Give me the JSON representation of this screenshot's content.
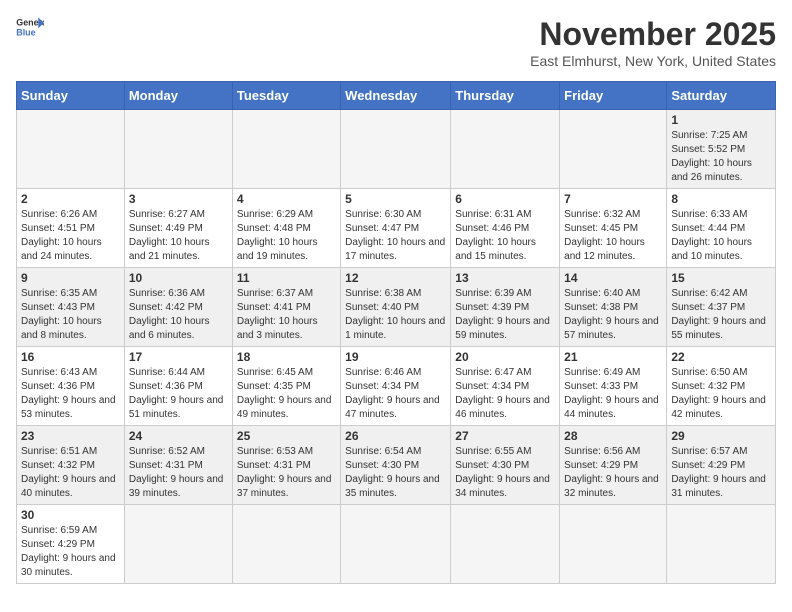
{
  "header": {
    "logo_general": "General",
    "logo_blue": "Blue",
    "month_title": "November 2025",
    "location": "East Elmhurst, New York, United States"
  },
  "weekdays": [
    "Sunday",
    "Monday",
    "Tuesday",
    "Wednesday",
    "Thursday",
    "Friday",
    "Saturday"
  ],
  "weeks": [
    [
      {
        "day": "",
        "info": ""
      },
      {
        "day": "",
        "info": ""
      },
      {
        "day": "",
        "info": ""
      },
      {
        "day": "",
        "info": ""
      },
      {
        "day": "",
        "info": ""
      },
      {
        "day": "",
        "info": ""
      },
      {
        "day": "1",
        "info": "Sunrise: 7:25 AM\nSunset: 5:52 PM\nDaylight: 10 hours and 26 minutes."
      }
    ],
    [
      {
        "day": "2",
        "info": "Sunrise: 6:26 AM\nSunset: 4:51 PM\nDaylight: 10 hours and 24 minutes."
      },
      {
        "day": "3",
        "info": "Sunrise: 6:27 AM\nSunset: 4:49 PM\nDaylight: 10 hours and 21 minutes."
      },
      {
        "day": "4",
        "info": "Sunrise: 6:29 AM\nSunset: 4:48 PM\nDaylight: 10 hours and 19 minutes."
      },
      {
        "day": "5",
        "info": "Sunrise: 6:30 AM\nSunset: 4:47 PM\nDaylight: 10 hours and 17 minutes."
      },
      {
        "day": "6",
        "info": "Sunrise: 6:31 AM\nSunset: 4:46 PM\nDaylight: 10 hours and 15 minutes."
      },
      {
        "day": "7",
        "info": "Sunrise: 6:32 AM\nSunset: 4:45 PM\nDaylight: 10 hours and 12 minutes."
      },
      {
        "day": "8",
        "info": "Sunrise: 6:33 AM\nSunset: 4:44 PM\nDaylight: 10 hours and 10 minutes."
      }
    ],
    [
      {
        "day": "9",
        "info": "Sunrise: 6:35 AM\nSunset: 4:43 PM\nDaylight: 10 hours and 8 minutes."
      },
      {
        "day": "10",
        "info": "Sunrise: 6:36 AM\nSunset: 4:42 PM\nDaylight: 10 hours and 6 minutes."
      },
      {
        "day": "11",
        "info": "Sunrise: 6:37 AM\nSunset: 4:41 PM\nDaylight: 10 hours and 3 minutes."
      },
      {
        "day": "12",
        "info": "Sunrise: 6:38 AM\nSunset: 4:40 PM\nDaylight: 10 hours and 1 minute."
      },
      {
        "day": "13",
        "info": "Sunrise: 6:39 AM\nSunset: 4:39 PM\nDaylight: 9 hours and 59 minutes."
      },
      {
        "day": "14",
        "info": "Sunrise: 6:40 AM\nSunset: 4:38 PM\nDaylight: 9 hours and 57 minutes."
      },
      {
        "day": "15",
        "info": "Sunrise: 6:42 AM\nSunset: 4:37 PM\nDaylight: 9 hours and 55 minutes."
      }
    ],
    [
      {
        "day": "16",
        "info": "Sunrise: 6:43 AM\nSunset: 4:36 PM\nDaylight: 9 hours and 53 minutes."
      },
      {
        "day": "17",
        "info": "Sunrise: 6:44 AM\nSunset: 4:36 PM\nDaylight: 9 hours and 51 minutes."
      },
      {
        "day": "18",
        "info": "Sunrise: 6:45 AM\nSunset: 4:35 PM\nDaylight: 9 hours and 49 minutes."
      },
      {
        "day": "19",
        "info": "Sunrise: 6:46 AM\nSunset: 4:34 PM\nDaylight: 9 hours and 47 minutes."
      },
      {
        "day": "20",
        "info": "Sunrise: 6:47 AM\nSunset: 4:34 PM\nDaylight: 9 hours and 46 minutes."
      },
      {
        "day": "21",
        "info": "Sunrise: 6:49 AM\nSunset: 4:33 PM\nDaylight: 9 hours and 44 minutes."
      },
      {
        "day": "22",
        "info": "Sunrise: 6:50 AM\nSunset: 4:32 PM\nDaylight: 9 hours and 42 minutes."
      }
    ],
    [
      {
        "day": "23",
        "info": "Sunrise: 6:51 AM\nSunset: 4:32 PM\nDaylight: 9 hours and 40 minutes."
      },
      {
        "day": "24",
        "info": "Sunrise: 6:52 AM\nSunset: 4:31 PM\nDaylight: 9 hours and 39 minutes."
      },
      {
        "day": "25",
        "info": "Sunrise: 6:53 AM\nSunset: 4:31 PM\nDaylight: 9 hours and 37 minutes."
      },
      {
        "day": "26",
        "info": "Sunrise: 6:54 AM\nSunset: 4:30 PM\nDaylight: 9 hours and 35 minutes."
      },
      {
        "day": "27",
        "info": "Sunrise: 6:55 AM\nSunset: 4:30 PM\nDaylight: 9 hours and 34 minutes."
      },
      {
        "day": "28",
        "info": "Sunrise: 6:56 AM\nSunset: 4:29 PM\nDaylight: 9 hours and 32 minutes."
      },
      {
        "day": "29",
        "info": "Sunrise: 6:57 AM\nSunset: 4:29 PM\nDaylight: 9 hours and 31 minutes."
      }
    ],
    [
      {
        "day": "30",
        "info": "Sunrise: 6:59 AM\nSunset: 4:29 PM\nDaylight: 9 hours and 30 minutes."
      },
      {
        "day": "",
        "info": ""
      },
      {
        "day": "",
        "info": ""
      },
      {
        "day": "",
        "info": ""
      },
      {
        "day": "",
        "info": ""
      },
      {
        "day": "",
        "info": ""
      },
      {
        "day": "",
        "info": ""
      }
    ]
  ]
}
